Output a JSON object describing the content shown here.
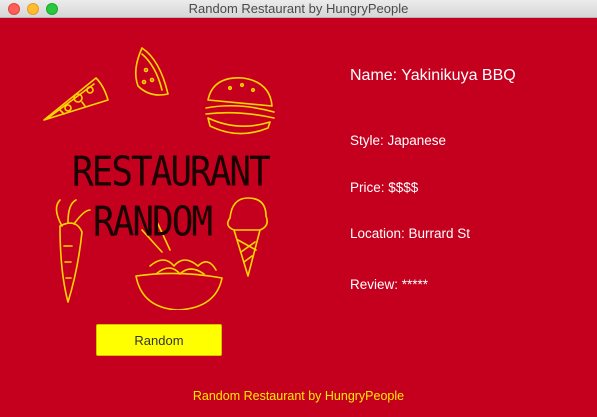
{
  "window": {
    "title": "Random Restaurant by HungryPeople"
  },
  "logo": {
    "line1": "RESTAURANT",
    "line2": "RANDOM",
    "art_color": "#ffd400",
    "text_color": "#1a0000"
  },
  "restaurant": {
    "name": "Name: Yakinikuya BBQ",
    "style": "Style: Japanese",
    "price": "Price: $$$$",
    "location": "Location: Burrard St",
    "review": "Review: *****"
  },
  "controls": {
    "random_label": "Random"
  },
  "footer": {
    "text": "Random Restaurant by HungryPeople"
  },
  "colors": {
    "background": "#c4001e",
    "button": "#ffff00",
    "footer_text": "#ffea00"
  }
}
